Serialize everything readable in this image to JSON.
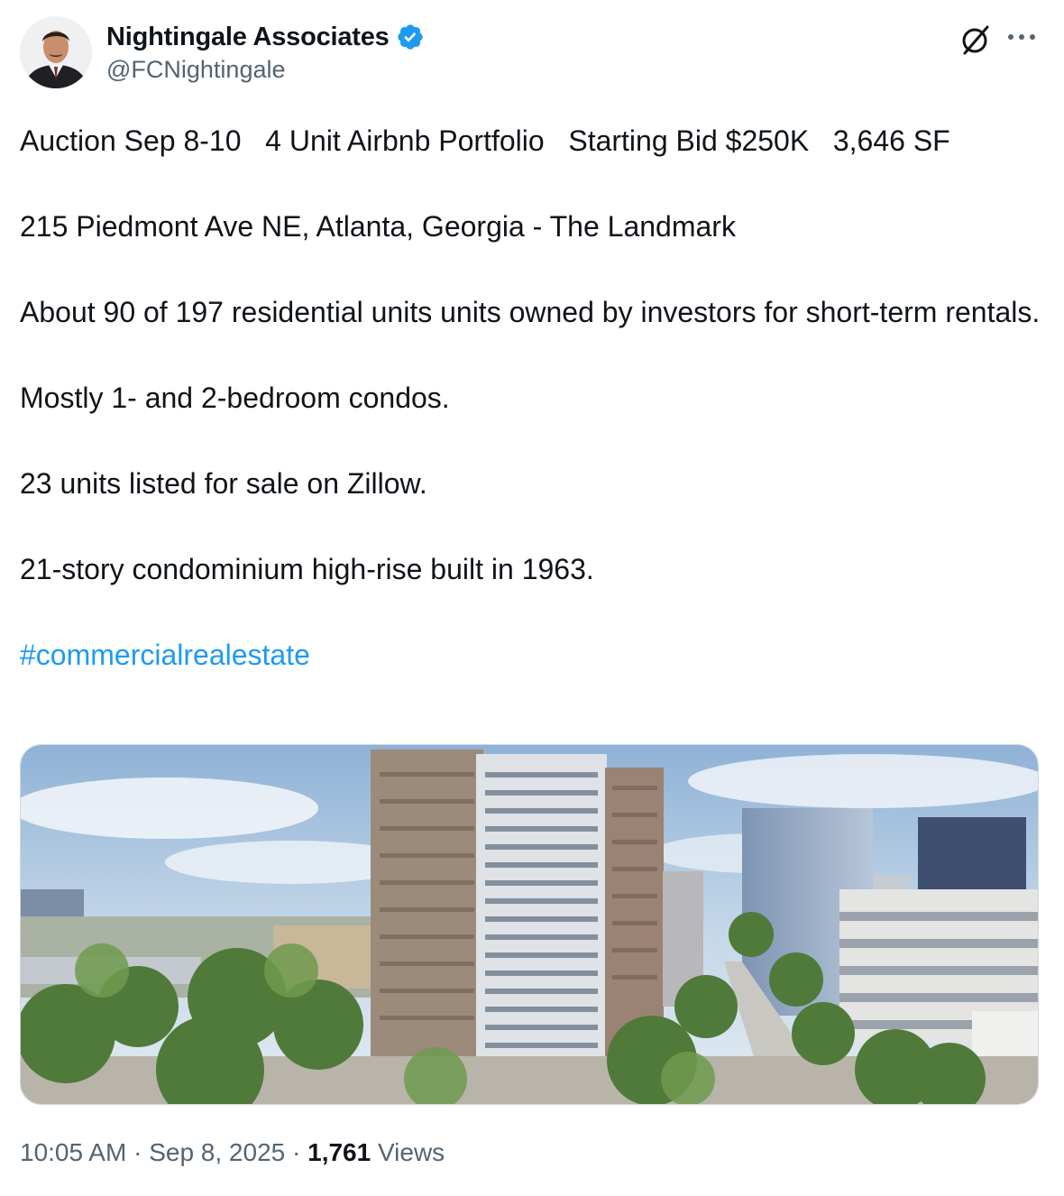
{
  "author": {
    "display_name": "Nightingale Associates",
    "handle": "@FCNightingale",
    "verified": true,
    "verified_color": "#1d9bf0"
  },
  "icons": {
    "top_right": [
      "grok-icon",
      "more-icon"
    ]
  },
  "tweet": {
    "line1": "Auction Sep 8-10   4 Unit Airbnb Portfolio   Starting Bid $250K   3,646 SF",
    "line2": "215 Piedmont Ave NE, Atlanta, Georgia - The Landmark",
    "line3": "About 90 of 197 residential units units owned by investors for short-term rentals.",
    "line4": "Mostly 1- and 2-bedroom condos.",
    "line5": "23 units listed for sale on Zillow.",
    "line6": "21-story condominium high-rise built in 1963.",
    "hashtag": "#commercialrealestate",
    "hashtag_color": "#1d9bf0"
  },
  "media": {
    "kind": "photo"
  },
  "meta": {
    "time": "10:05 AM",
    "separator": " · ",
    "date": "Sep 8, 2025",
    "views_count": "1,761",
    "views_label": " Views"
  }
}
